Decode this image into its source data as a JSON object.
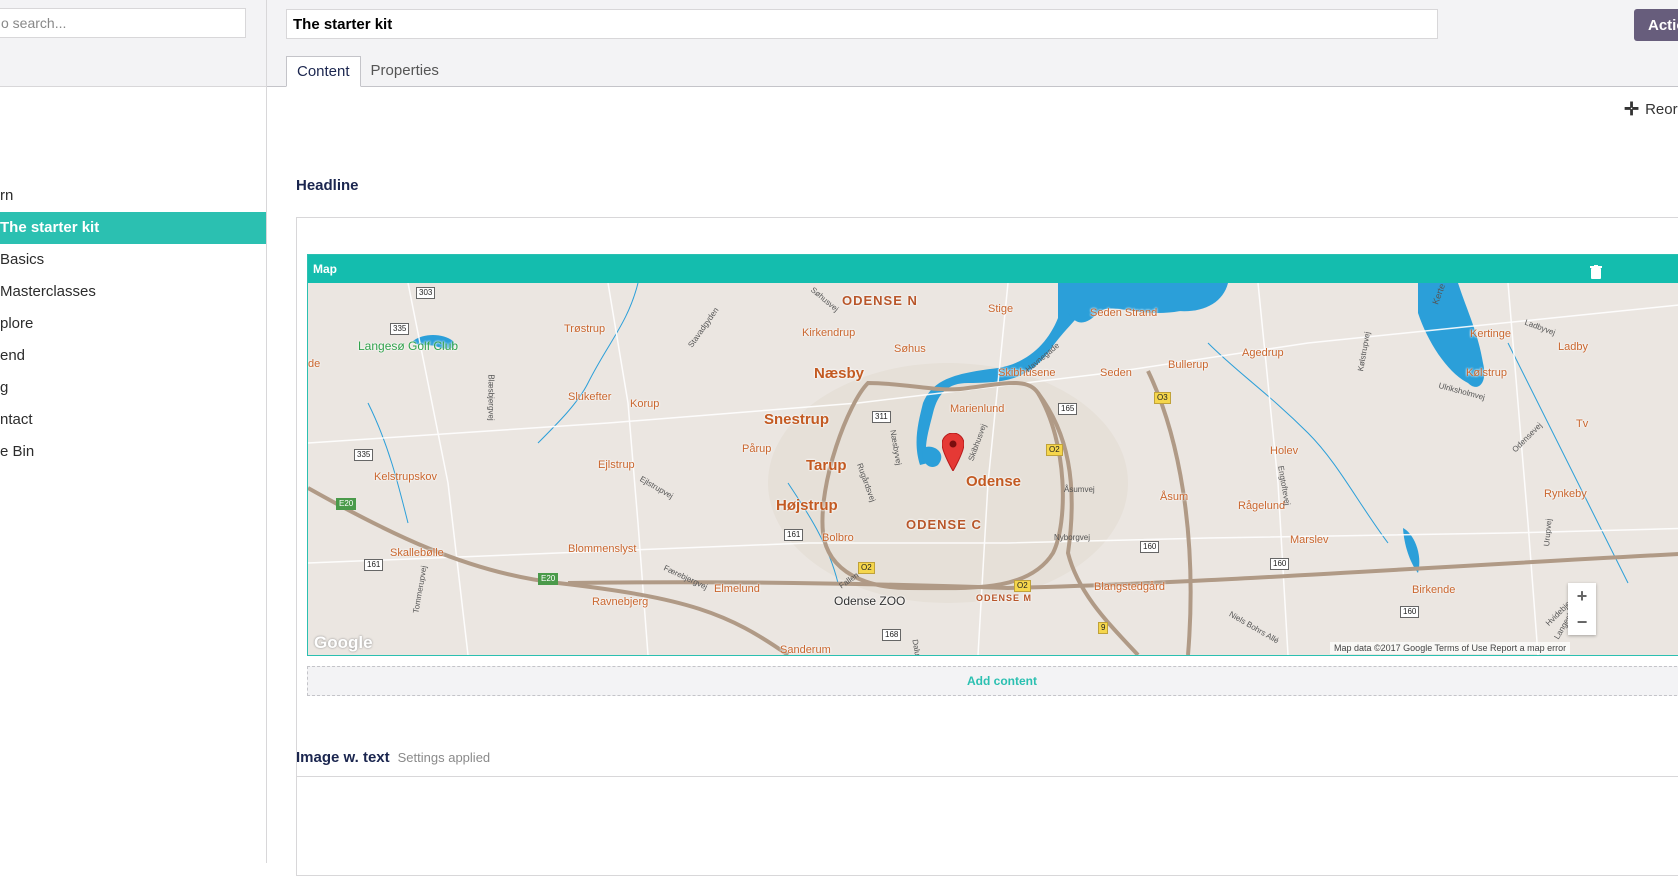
{
  "tree": {
    "search_placeholder": "o search...",
    "items": [
      {
        "label": "rn",
        "indent": 0
      },
      {
        "label": "The starter kit",
        "indent": 0,
        "active": true
      },
      {
        "label": "Basics",
        "indent": 0
      },
      {
        "label": "Masterclasses",
        "indent": 0
      },
      {
        "label": "plore",
        "indent": 0
      },
      {
        "label": "end",
        "indent": 0
      },
      {
        "label": "g",
        "indent": 0
      },
      {
        "label": "ntact",
        "indent": 0
      },
      {
        "label": "e Bin",
        "indent": 0
      }
    ]
  },
  "header": {
    "name": "The starter kit",
    "actions_label": "Actio",
    "tabs": [
      {
        "label": "Content",
        "active": true
      },
      {
        "label": "Properties",
        "active": false
      }
    ]
  },
  "content": {
    "reorder_label": "Reord",
    "headline_label": "Headline",
    "map_editor_title": "Map",
    "add_content": "Add content",
    "image_text_label": "Image w. text",
    "image_text_desc": "Settings applied"
  },
  "map": {
    "places": {
      "odense_n": "ODENSE N",
      "stige": "Stige",
      "seden_strand": "Seden Strand",
      "kertinge": "Kertinge",
      "ladby": "Ladby",
      "kolstrup": "Kølstrup",
      "trostrup": "Trøstrup",
      "kirkendrup": "Kirkendrup",
      "sohus": "Søhus",
      "langeso": "Langesø Golf Club",
      "naesby": "Næsby",
      "skibhusene": "Skibhusene",
      "seden": "Seden",
      "bullerup": "Bullerup",
      "agedrup": "Agedrup",
      "slukefter": "Slukefter",
      "korup": "Korup",
      "snestrup": "Snestrup",
      "marienlund": "Marienlund",
      "parup": "Pårup",
      "tarup": "Tarup",
      "holev": "Holev",
      "ejlstrup": "Ejlstrup",
      "odense": "Odense",
      "asum": "Åsum",
      "kelstrupskov": "Kelstrupskov",
      "hojstrup": "Højstrup",
      "ragelund": "Rågelund",
      "rynkeby": "Rynkeby",
      "odense_c": "ODENSE C",
      "bolbro": "Bolbro",
      "marslev": "Marslev",
      "skallebolle": "Skallebølle",
      "blommenslyst": "Blommenslyst",
      "elmelund": "Elmelund",
      "odense_zoo": "Odense ZOO",
      "odense_m": "ODENSE M",
      "blangstedgard": "Blangstedgård",
      "ravnebjerg": "Ravnebjerg",
      "birkende": "Birkende",
      "sanderum": "Sanderum",
      "de": "de",
      "tv": "Tv"
    },
    "roads": {
      "sohusvej": "Søhusvej",
      "stavadsvej": "Stavadgyden",
      "blaesbjergvej": "Blæsbjergvej",
      "havnegade": "Havnegade",
      "skibhusvej": "Skibhusvej",
      "naesbyvej": "Næsbyvej",
      "rugardsvej": "Rugårdsvej",
      "ejlstrupvej": "Ejlstrupvej",
      "asumvej": "Åsumvej",
      "nyborgvej": "Nyborgvej",
      "faerebjergvej": "Færebjergvej",
      "fallen": "Fallen",
      "niels_bohrs": "Niels Bohrs Allé",
      "tommerupvej": "Tommerupvej",
      "odensevej": "Odensevej",
      "engtoftevej": "Engtoftevej",
      "kolstrupvej": "Kølstrupvej",
      "ulriksholmvej": "Ulriksholmvej",
      "ladbyvej": "Ladbyvej",
      "hvidebjergvej": "Hvidebjergvej",
      "langeskovvej": "Langeskovvej",
      "urupvej": "Urupvej",
      "dalumvej": "Dalu",
      "landevej": "Landevej"
    },
    "shields": {
      "r303": "303",
      "r335a": "335",
      "r335b": "335",
      "e20a": "E20",
      "e20b": "E20",
      "r161a": "161",
      "r161b": "161",
      "r311": "311",
      "r165": "165",
      "o3": "O3",
      "o2a": "O2",
      "o2b": "O2",
      "o2c": "O2",
      "r160a": "160",
      "r160b": "160",
      "r160c": "160",
      "r168": "168",
      "r9": "9",
      "kerte": "Kerte"
    },
    "google_logo": "Google",
    "attribution": "Map data ©2017 Google    Terms of Use    Report a map error",
    "zoom_in": "+",
    "zoom_out": "−",
    "colors": {
      "water": "#2b9fd9",
      "land": "#ebe6e1",
      "highway": "#b09a86",
      "accent": "#2bc0b1",
      "marker": "#e53935"
    }
  }
}
